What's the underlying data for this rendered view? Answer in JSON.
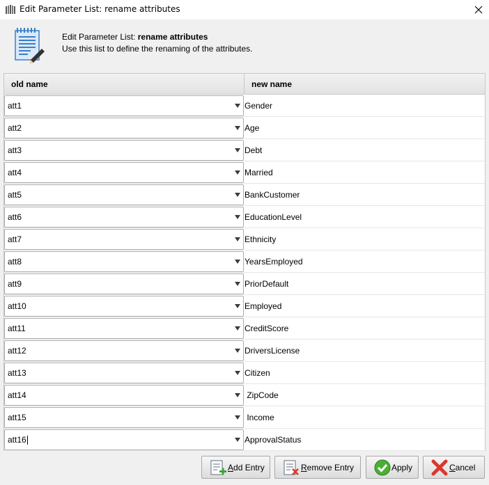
{
  "window": {
    "title": "Edit Parameter List: rename attributes",
    "close_glyph": "✕"
  },
  "header": {
    "line1_prefix": "Edit Parameter List: ",
    "line1_bold": "rename attributes",
    "line2": "Use this list to define the renaming of the attributes."
  },
  "table": {
    "columns": [
      "old name",
      "new name"
    ],
    "rows": [
      {
        "old": "att1",
        "new": "Gender"
      },
      {
        "old": "att2",
        "new": "Age"
      },
      {
        "old": "att3",
        "new": "Debt"
      },
      {
        "old": "att4",
        "new": "Married"
      },
      {
        "old": "att5",
        "new": "BankCustomer"
      },
      {
        "old": "att6",
        "new": "EducationLevel"
      },
      {
        "old": "att7",
        "new": "Ethnicity"
      },
      {
        "old": "att8",
        "new": "YearsEmployed"
      },
      {
        "old": "att9",
        "new": "PriorDefault"
      },
      {
        "old": "att10",
        "new": "Employed"
      },
      {
        "old": "att11",
        "new": "CreditScore"
      },
      {
        "old": "att12",
        "new": "DriversLicense"
      },
      {
        "old": "att13",
        "new": "Citizen"
      },
      {
        "old": "att14",
        "new": " ZipCode"
      },
      {
        "old": "att15",
        "new": " Income"
      },
      {
        "old": "att16",
        "new": "ApprovalStatus"
      }
    ]
  },
  "buttons": {
    "add_mnemonic": "A",
    "add_rest": "dd Entry",
    "remove_mnemonic": "R",
    "remove_rest": "emove Entry",
    "apply": "Apply",
    "cancel_mnemonic": "C",
    "cancel_rest": "ancel"
  },
  "icons": {
    "app": "rapidminer-app-icon",
    "header": "document-edit-icon",
    "add": "add-entry-icon",
    "remove": "remove-entry-icon",
    "apply": "checkmark-icon",
    "cancel": "cross-icon"
  },
  "colors": {
    "apply_green": "#4caf32",
    "cancel_red": "#d9382c",
    "doc_blue": "#3a7fc8"
  }
}
